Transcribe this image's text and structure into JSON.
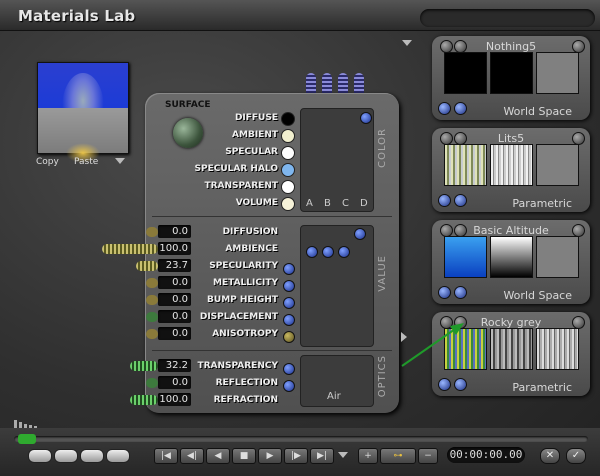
{
  "window": {
    "title": "Materials Lab"
  },
  "preview": {
    "copy_label": "Copy",
    "paste_label": "Paste"
  },
  "surface": {
    "heading": "SURFACE",
    "column_letters": [
      "A",
      "B",
      "C",
      "D"
    ],
    "air_label": "Air"
  },
  "sections": {
    "color": "COLOR",
    "value": "VALUE",
    "optics": "OPTICS"
  },
  "color_rows": [
    {
      "label": "DIFFUSE",
      "swatch": "#000000"
    },
    {
      "label": "AMBIENT",
      "swatch": "#f1efcf"
    },
    {
      "label": "SPECULAR",
      "swatch": "#ffffff"
    },
    {
      "label": "SPECULAR HALO",
      "swatch": "#7fb6ee"
    },
    {
      "label": "TRANSPARENT",
      "swatch": "#ffffff"
    },
    {
      "label": "VOLUME",
      "swatch": "#f6f2d8"
    }
  ],
  "value_rows": [
    {
      "label": "DIFFUSION",
      "value": "0.0"
    },
    {
      "label": "AMBIENCE",
      "value": "100.0"
    },
    {
      "label": "SPECULARITY",
      "value": "23.7"
    },
    {
      "label": "METALLICITY",
      "value": "0.0"
    },
    {
      "label": "BUMP HEIGHT",
      "value": "0.0"
    },
    {
      "label": "DISPLACEMENT",
      "value": "0.0"
    },
    {
      "label": "ANISOTROPY",
      "value": "0.0"
    }
  ],
  "optics_rows": [
    {
      "label": "TRANSPARENCY",
      "value": "32.2"
    },
    {
      "label": "REFLECTION",
      "value": "0.0"
    },
    {
      "label": "REFRACTION",
      "value": "100.0"
    }
  ],
  "presets": [
    {
      "name": "Nothing5",
      "space": "World Space"
    },
    {
      "name": "Lits5",
      "space": "Parametric"
    },
    {
      "name": "Basic Altitude",
      "space": "World Space"
    },
    {
      "name": "Rocky grey",
      "space": "Parametric"
    }
  ],
  "timeline": {
    "time": "00:00:00.00",
    "transport": [
      "|◀",
      "◀|",
      "◀",
      "■",
      "▶",
      "|▶",
      "▶|"
    ],
    "add_label": "+",
    "key_label": "⊶",
    "minus_label": "−",
    "cancel_label": "✕",
    "ok_label": "✓"
  }
}
